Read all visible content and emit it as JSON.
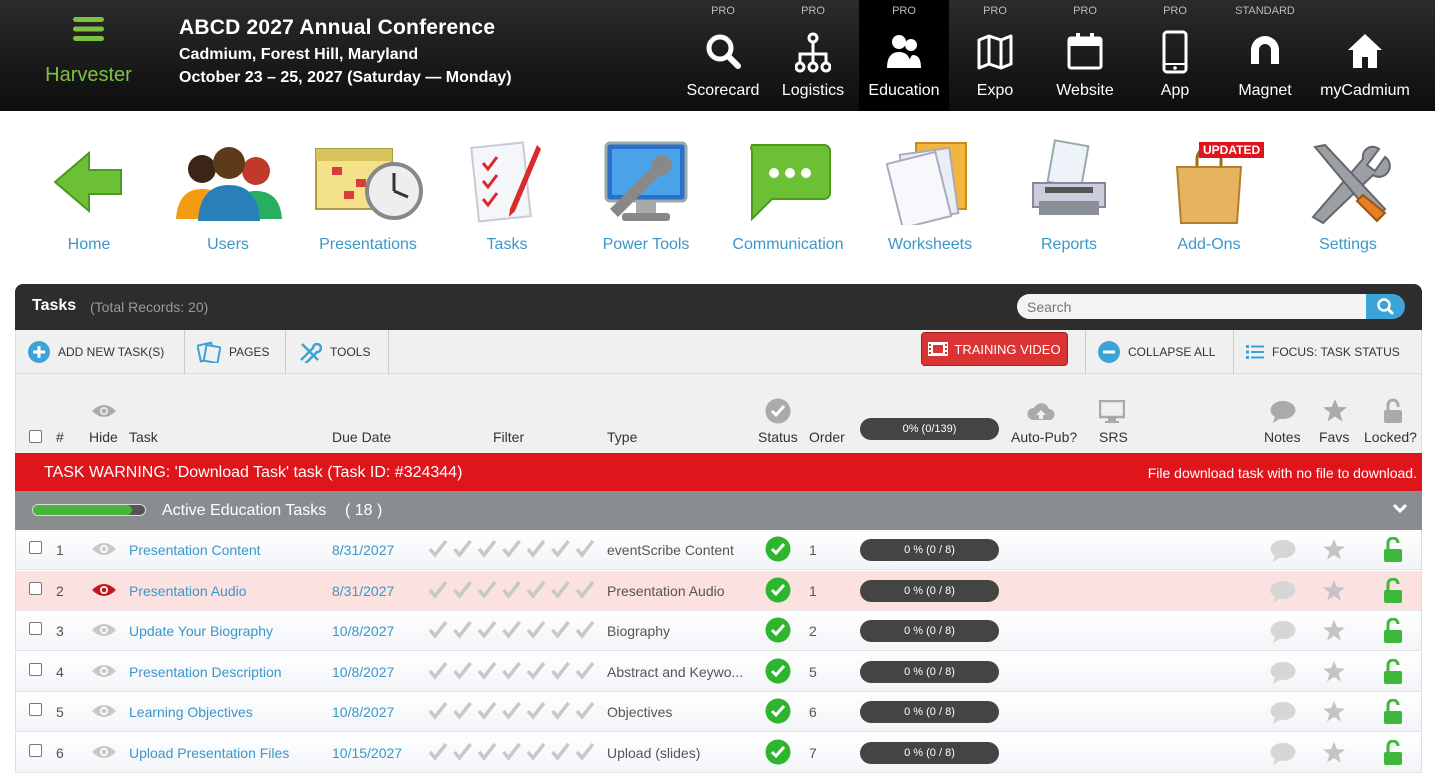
{
  "brand": {
    "name": "Harvester"
  },
  "conference": {
    "title": "ABCD 2027 Annual Conference",
    "location": "Cadmium, Forest Hill, Maryland",
    "dates": "October 23 – 25, 2027 (Saturday — Monday)"
  },
  "modules": [
    {
      "tier": "PRO",
      "label": "Scorecard",
      "icon": "search-icon"
    },
    {
      "tier": "PRO",
      "label": "Logistics",
      "icon": "hierarchy-icon"
    },
    {
      "tier": "PRO",
      "label": "Education",
      "icon": "users-icon"
    },
    {
      "tier": "PRO",
      "label": "Expo",
      "icon": "map-icon"
    },
    {
      "tier": "PRO",
      "label": "Website",
      "icon": "calendar-icon"
    },
    {
      "tier": "PRO",
      "label": "App",
      "icon": "phone-icon"
    },
    {
      "tier": "STANDARD",
      "label": "Magnet",
      "icon": "magnet-icon"
    },
    {
      "tier": "",
      "label": "myCadmium",
      "icon": "home-icon"
    }
  ],
  "apps": [
    {
      "label": "Home"
    },
    {
      "label": "Users"
    },
    {
      "label": "Presentations"
    },
    {
      "label": "Tasks"
    },
    {
      "label": "Power Tools"
    },
    {
      "label": "Communication"
    },
    {
      "label": "Worksheets"
    },
    {
      "label": "Reports"
    },
    {
      "label": "Add-Ons"
    },
    {
      "label": "Settings"
    }
  ],
  "updated_badge": "UPDATED",
  "panel": {
    "title": "Tasks",
    "count": "(Total Records: 20)",
    "search_placeholder": "Search"
  },
  "toolbar": {
    "add": "ADD NEW TASK(S)",
    "pages": "PAGES",
    "tools": "TOOLS",
    "training": "TRAINING VIDEO",
    "collapse": "COLLAPSE ALL",
    "focus": "FOCUS: TASK STATUS"
  },
  "columns": {
    "num": "#",
    "hide": "Hide",
    "task": "Task",
    "due": "Due Date",
    "filter": "Filter",
    "type": "Type",
    "status": "Status",
    "order": "Order",
    "progress": "0% (0/139)",
    "autopub": "Auto-Pub?",
    "srs": "SRS",
    "notes": "Notes",
    "favs": "Favs",
    "locked": "Locked?"
  },
  "warning": {
    "left": "TASK WARNING: 'Download Task' task (Task ID: #324344)",
    "right": "File download task with no file to download."
  },
  "group": {
    "label": "Active Education Tasks",
    "count": "( 18 )",
    "progress": 0.88
  },
  "rows": [
    {
      "num": "1",
      "task": "Presentation Content",
      "due": "8/31/2027",
      "type": "eventScribe Content",
      "order": "1",
      "progress": "0 % (0 / 8)",
      "hidden": false
    },
    {
      "num": "2",
      "task": "Presentation Audio",
      "due": "8/31/2027",
      "type": "Presentation Audio",
      "order": "1",
      "progress": "0 % (0 / 8)",
      "hidden": true
    },
    {
      "num": "3",
      "task": "Update Your Biography",
      "due": "10/8/2027",
      "type": "Biography",
      "order": "2",
      "progress": "0 % (0 / 8)",
      "hidden": false
    },
    {
      "num": "4",
      "task": "Presentation Description",
      "due": "10/8/2027",
      "type": "Abstract and Keywo...",
      "order": "5",
      "progress": "0 % (0 / 8)",
      "hidden": false
    },
    {
      "num": "5",
      "task": "Learning Objectives",
      "due": "10/8/2027",
      "type": "Objectives",
      "order": "6",
      "progress": "0 % (0 / 8)",
      "hidden": false
    },
    {
      "num": "6",
      "task": "Upload Presentation Files",
      "due": "10/15/2027",
      "type": "Upload (slides)",
      "order": "7",
      "progress": "0 % (0 / 8)",
      "hidden": false
    }
  ],
  "colors": {
    "accent": "#3a97c9",
    "warning": "#e0151c",
    "brand_green": "#7cc142",
    "status_green": "#2db52d",
    "lock_green": "#3db83a"
  }
}
